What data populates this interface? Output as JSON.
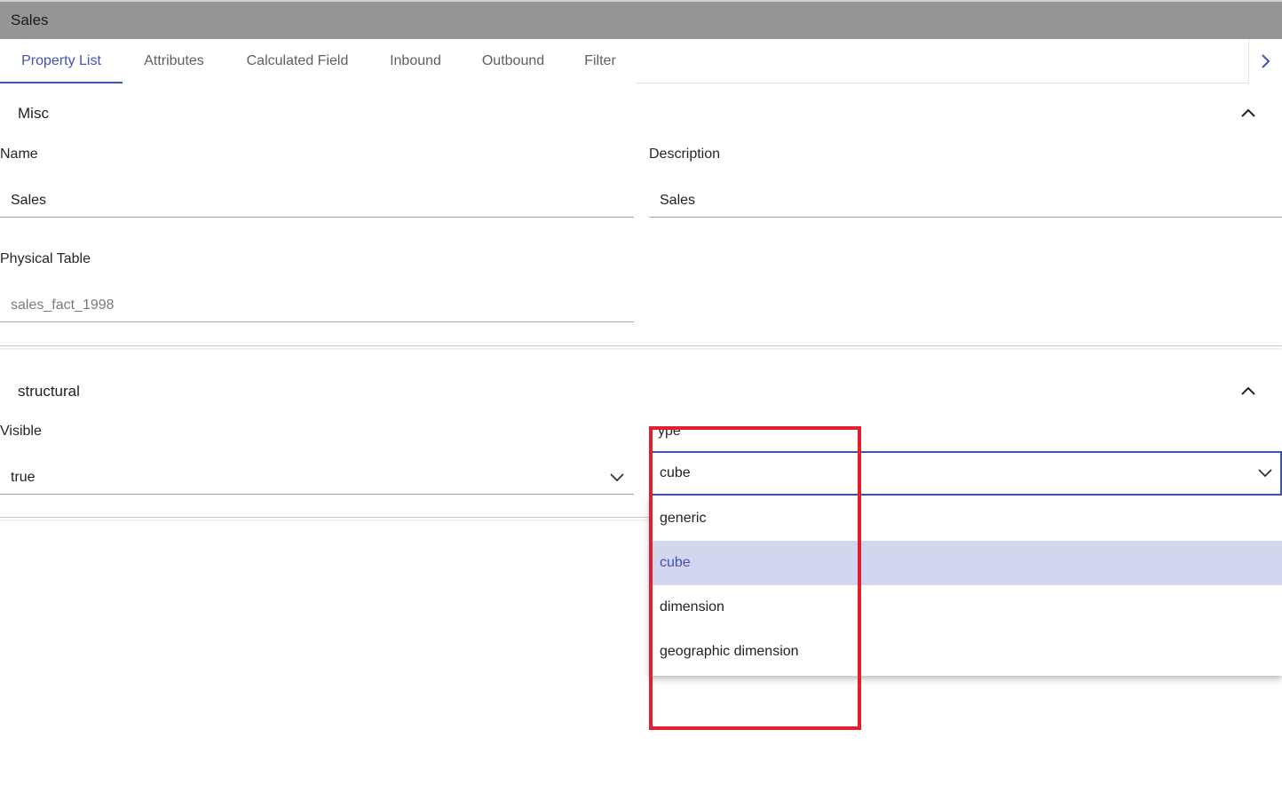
{
  "window": {
    "title": "Sales"
  },
  "tabs": [
    {
      "label": "Property List",
      "active": true
    },
    {
      "label": "Attributes"
    },
    {
      "label": "Calculated Field"
    },
    {
      "label": "Inbound"
    },
    {
      "label": "Outbound"
    },
    {
      "label": "Filter"
    }
  ],
  "misc": {
    "title": "Misc",
    "name_label": "Name",
    "name_value": "Sales",
    "description_label": "Description",
    "description_value": "Sales",
    "physical_table_label": "Physical Table",
    "physical_table_value": "sales_fact_1998"
  },
  "structural": {
    "title": "structural",
    "visible_label": "Visible",
    "visible_value": "true",
    "type_label": "ype",
    "type_value": "cube",
    "type_options": [
      "generic",
      "cube",
      "dimension",
      "geographic dimension"
    ],
    "selected_option": "cube"
  },
  "colors": {
    "accent": "#3f51b5",
    "titlebar": "#959595",
    "selected_bg": "#d3d6ef",
    "highlight": "#e0202e"
  }
}
